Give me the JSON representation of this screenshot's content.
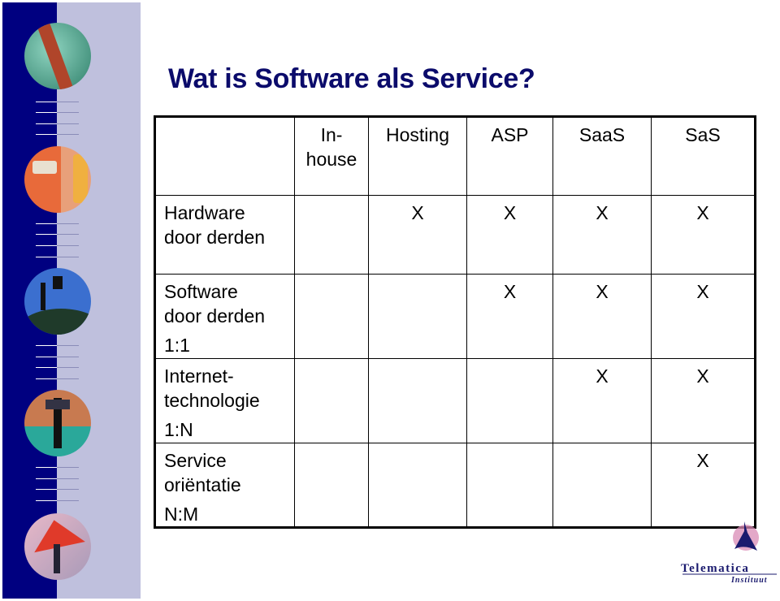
{
  "slide": {
    "title": "Wat is Software als Service?",
    "colors": {
      "title": "#0b0b6b",
      "sidebar_dark": "#000080",
      "sidebar_light": "#bfc0dd"
    }
  },
  "table": {
    "columns": [
      "In-house",
      "Hosting",
      "ASP",
      "SaaS",
      "SaS"
    ],
    "column_lines": [
      [
        "In-",
        "house"
      ],
      [
        "Hosting"
      ],
      [
        "ASP"
      ],
      [
        "SaaS"
      ],
      [
        "SaS"
      ]
    ],
    "rows": [
      {
        "label_lines": [
          "Hardware",
          "door derden"
        ],
        "ratio": "",
        "marks": [
          "",
          "X",
          "X",
          "X",
          "X"
        ]
      },
      {
        "label_lines": [
          "Software",
          "door derden"
        ],
        "ratio": "1:1",
        "marks": [
          "",
          "",
          "X",
          "X",
          "X"
        ]
      },
      {
        "label_lines": [
          "Internet-",
          "technologie"
        ],
        "ratio": "1:N",
        "marks": [
          "",
          "",
          "",
          "X",
          "X"
        ]
      },
      {
        "label_lines": [
          "Service",
          "oriëntatie"
        ],
        "ratio": "N:M",
        "marks": [
          "",
          "",
          "",
          "",
          "X"
        ]
      }
    ]
  },
  "logo": {
    "name": "Telematica",
    "subname": "Instituut",
    "colors": {
      "text": "#1a1a6e",
      "accent": "#d98bb5"
    }
  },
  "sidebar": {
    "images": [
      "cable-rope-photo",
      "network-plug-photo",
      "artist-easel-photo",
      "man-with-book-photo",
      "man-lifting-triangle-photo"
    ]
  }
}
